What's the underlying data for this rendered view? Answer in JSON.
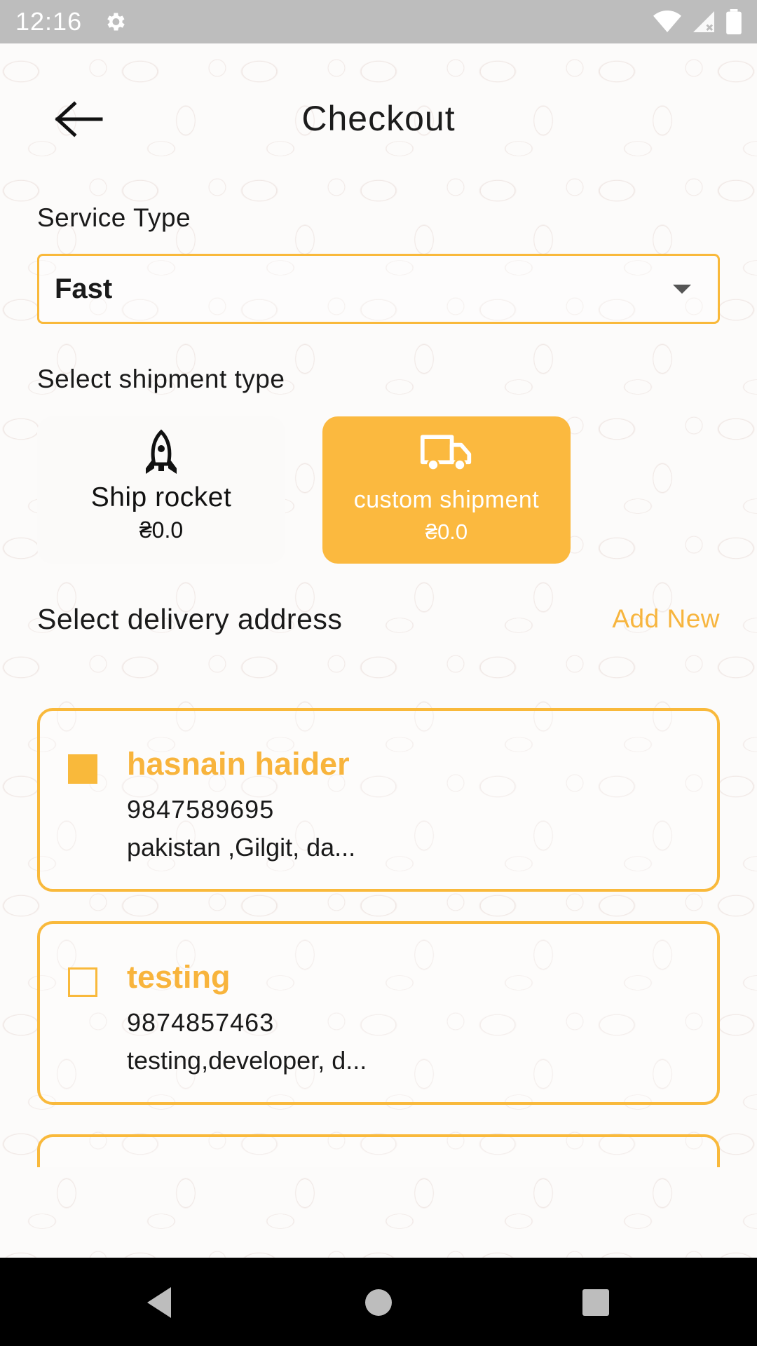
{
  "status_bar": {
    "time": "12:16",
    "icons": [
      "gear-icon",
      "wifi-icon",
      "signal-icon",
      "battery-icon"
    ]
  },
  "header": {
    "title": "Checkout",
    "back_icon": "arrow-left-icon"
  },
  "service_type": {
    "label": "Service Type",
    "selected": "Fast"
  },
  "shipment": {
    "label": "Select shipment type",
    "options": [
      {
        "name": "Ship rocket",
        "price": "₴0.0",
        "icon": "rocket-icon",
        "selected": false
      },
      {
        "name": "custom shipment",
        "price": "₴0.0",
        "icon": "truck-icon",
        "selected": true
      }
    ]
  },
  "delivery": {
    "label": "Select delivery address",
    "add_new": "Add New",
    "addresses": [
      {
        "name": "hasnain haider",
        "phone": "9847589695",
        "address": "pakistan ,Gilgit, da...",
        "selected": true
      },
      {
        "name": "testing",
        "phone": "9874857463",
        "address": "testing,developer, d...",
        "selected": false
      },
      {
        "name": "",
        "phone": "",
        "address": "",
        "selected": false
      }
    ]
  },
  "colors": {
    "accent": "#f9b93b",
    "status_bar": "#bdbdbd",
    "nav_bar": "#000000"
  },
  "nav_bar": {
    "buttons": [
      "nav-back-icon",
      "nav-home-icon",
      "nav-recent-icon"
    ]
  }
}
